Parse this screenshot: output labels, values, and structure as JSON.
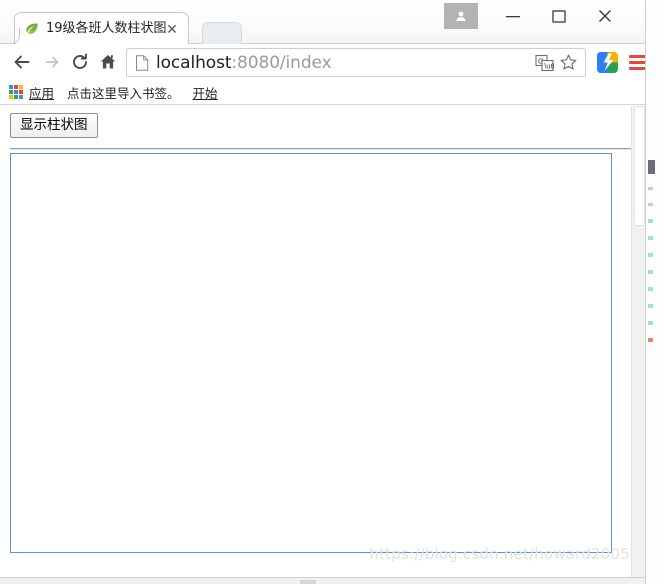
{
  "window": {
    "controls": {
      "avatar": "profile-avatar",
      "minimize": "—",
      "maximize": "□",
      "close": "✕"
    }
  },
  "tabs": [
    {
      "title": "19级各班人数柱状图",
      "favicon": "green-leaf-icon",
      "close_label": "✕",
      "active": true
    }
  ],
  "new_tab_label": "",
  "toolbar": {
    "back_icon": "arrow-left-icon",
    "forward_icon": "arrow-right-icon",
    "reload_icon": "reload-icon",
    "home_icon": "home-icon",
    "omnibox": {
      "page_icon": "document-icon",
      "url_host": "localhost",
      "url_path": ":8080/index",
      "full_url": "localhost:8080/index",
      "translate_icon": "translate-icon",
      "bookmark_icon": "star-outline-icon"
    },
    "extension_icon": "browser-extension-icon",
    "menu_icon": "hamburger-menu-icon"
  },
  "bookmarks_bar": {
    "apps_icon": "apps-grid-icon",
    "items": [
      {
        "label": "应用",
        "underlined": true
      },
      {
        "label": "点击这里导入书签。",
        "underlined": false
      },
      {
        "label": "开始",
        "underlined": true
      }
    ]
  },
  "page": {
    "show_chart_button": "显示柱状图",
    "chart_container": {
      "empty": true,
      "border_color": "#5b8fe0",
      "content": ""
    },
    "watermark": "https://blog.csdn.net/howard2005"
  },
  "colors": {
    "tab_border": "#c8c8c8",
    "chart_border": "#5b8fe0",
    "menu_red": "#e8453c",
    "url_host": "#1f1f1f",
    "url_path": "#9b9b9b",
    "watermark": "#e2e2e2"
  }
}
